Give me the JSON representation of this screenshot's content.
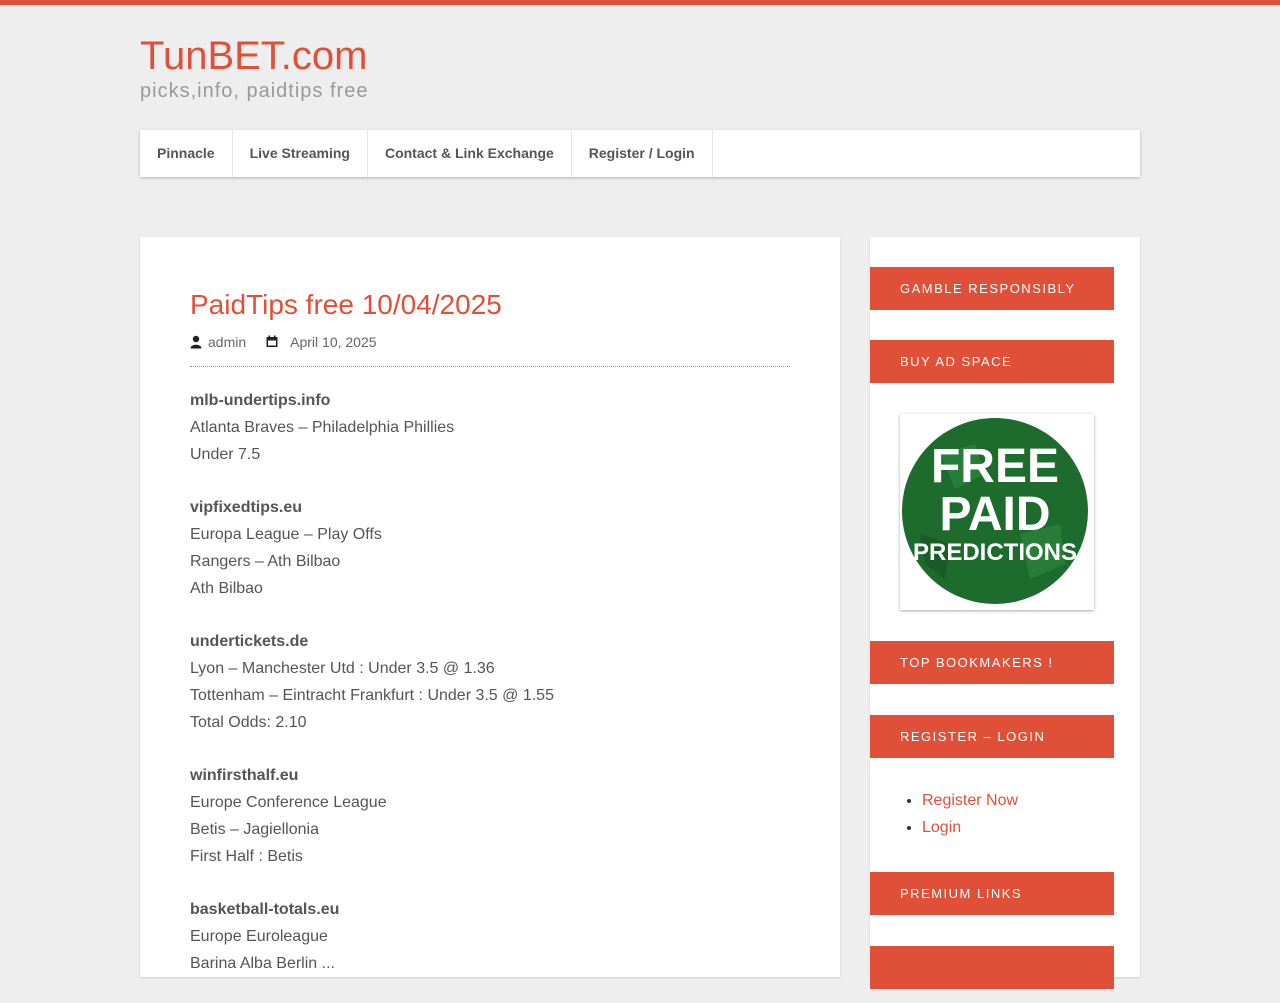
{
  "site": {
    "title": "TunBET.com",
    "tagline": "picks,info, paidtips free"
  },
  "nav": {
    "items": [
      {
        "label": "Pinnacle"
      },
      {
        "label": "Live Streaming"
      },
      {
        "label": "Contact & Link Exchange"
      },
      {
        "label": "Register / Login"
      }
    ]
  },
  "post": {
    "title": "PaidTips free 10/04/2025",
    "author": "admin",
    "date": "April 10, 2025",
    "author_icon": "user-icon",
    "date_icon": "calendar-icon",
    "blocks": [
      {
        "source": "mlb-undertips.info",
        "lines": [
          "Atlanta Braves – Philadelphia Phillies",
          "Under 7.5"
        ]
      },
      {
        "source": "vipfixedtips.eu",
        "lines": [
          "Europa League – Play Offs",
          "Rangers – Ath Bilbao",
          "Ath Bilbao"
        ]
      },
      {
        "source": "undertickets.de",
        "lines": [
          "Lyon – Manchester Utd : Under 3.5 @ 1.36",
          "Tottenham – Eintracht Frankfurt : Under 3.5 @ 1.55",
          "Total Odds: 2.10"
        ]
      },
      {
        "source": "winfirsthalf.eu",
        "lines": [
          "Europe Conference League",
          "Betis – Jagiellonia",
          "First Half : Betis"
        ]
      },
      {
        "source": "basketball-totals.eu",
        "lines": [
          "Europe Euroleague",
          "Barina Alba Berlin ..."
        ]
      }
    ]
  },
  "sidebar": {
    "widgets": {
      "gamble": "GAMBLE RESPONSIBLY",
      "buy_ad": "BUY AD SPACE",
      "top_bookmakers": "TOP BOOKMAKERS !",
      "register": "REGISTER – LOGIN",
      "premium": "PREMIUM LINKS"
    },
    "ad_image": {
      "text_line1": "FREE",
      "text_line2": "PAID",
      "text_line3": "PREDICTIONS"
    },
    "register_links": [
      {
        "label": "Register Now"
      },
      {
        "label": "Login"
      }
    ]
  },
  "colors": {
    "accent": "#e05038",
    "background": "#eeeeee",
    "badge_green": "#1e6b2e"
  }
}
